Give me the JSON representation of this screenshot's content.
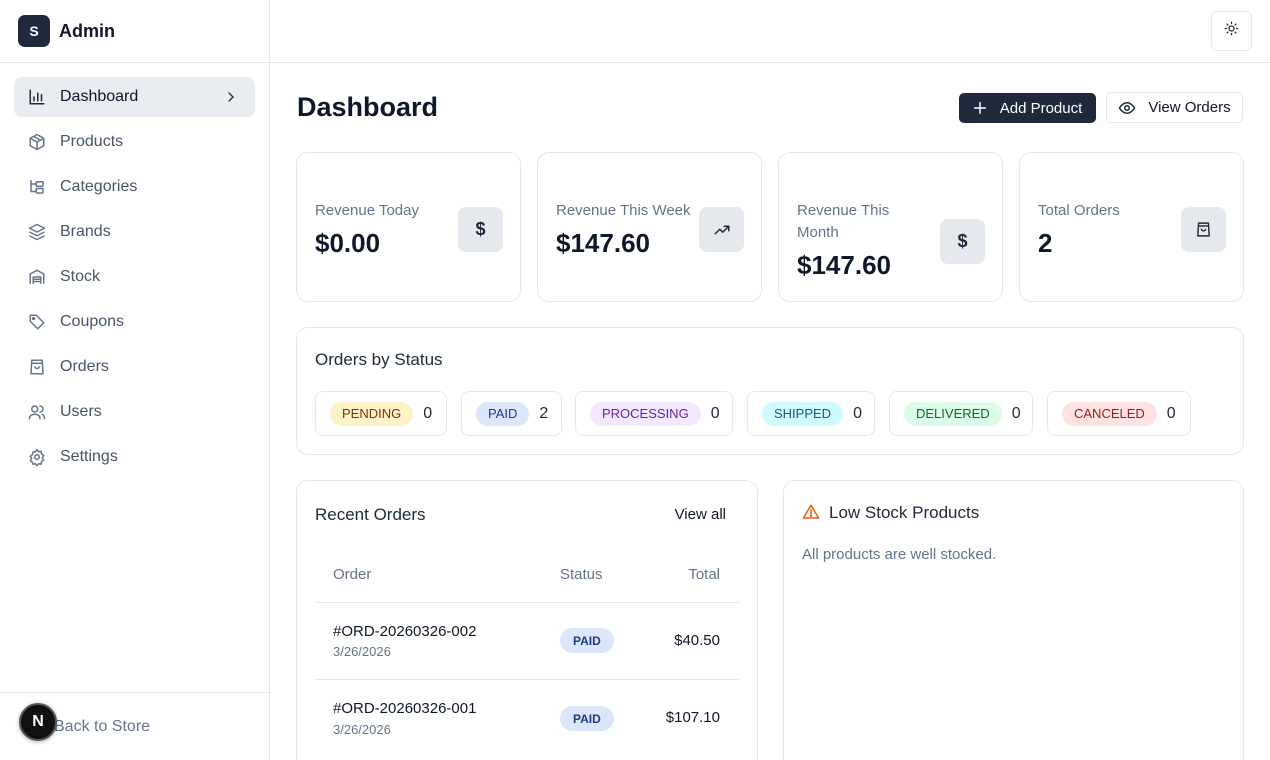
{
  "brand": {
    "logo_letter": "S",
    "name": "Admin"
  },
  "sidebar": {
    "items": [
      {
        "label": "Dashboard",
        "icon": "bar-chart-icon",
        "active": true
      },
      {
        "label": "Products",
        "icon": "package-icon"
      },
      {
        "label": "Categories",
        "icon": "folder-tree-icon"
      },
      {
        "label": "Brands",
        "icon": "layers-icon"
      },
      {
        "label": "Stock",
        "icon": "warehouse-icon"
      },
      {
        "label": "Coupons",
        "icon": "tag-icon"
      },
      {
        "label": "Orders",
        "icon": "shopping-bag-icon"
      },
      {
        "label": "Users",
        "icon": "users-icon"
      },
      {
        "label": "Settings",
        "icon": "gear-icon"
      }
    ],
    "footer_label": "Back to Store",
    "dev_badge": "N"
  },
  "header": {
    "theme_icon": "sun-icon"
  },
  "page": {
    "title": "Dashboard",
    "add_product_label": "Add Product",
    "view_orders_label": "View Orders"
  },
  "stats": [
    {
      "label": "Revenue Today",
      "value": "$0.00",
      "icon": "dollar-icon"
    },
    {
      "label": "Revenue This Week",
      "value": "$147.60",
      "icon": "trending-up-icon"
    },
    {
      "label": "Revenue This Month",
      "value": "$147.60",
      "icon": "dollar-icon"
    },
    {
      "label": "Total Orders",
      "value": "2",
      "icon": "shopping-bag-icon"
    }
  ],
  "orders_by_status": {
    "title": "Orders by Status",
    "items": [
      {
        "label": "PENDING",
        "count": "0",
        "bg": "#fef3c7",
        "fg": "#78350f"
      },
      {
        "label": "PAID",
        "count": "2",
        "bg": "#dbe6fa",
        "fg": "#1e3a8a"
      },
      {
        "label": "PROCESSING",
        "count": "0",
        "bg": "#f3e8ff",
        "fg": "#6b21a8"
      },
      {
        "label": "SHIPPED",
        "count": "0",
        "bg": "#cffafe",
        "fg": "#155e75"
      },
      {
        "label": "DELIVERED",
        "count": "0",
        "bg": "#dcfce7",
        "fg": "#166534"
      },
      {
        "label": "CANCELED",
        "count": "0",
        "bg": "#fee2e2",
        "fg": "#991b1b"
      }
    ]
  },
  "recent_orders": {
    "title": "Recent Orders",
    "view_all": "View all",
    "columns": [
      "Order",
      "Status",
      "Total"
    ],
    "rows": [
      {
        "id": "#ORD-20260326-002",
        "date": "3/26/2026",
        "status": "PAID",
        "total": "$40.50"
      },
      {
        "id": "#ORD-20260326-001",
        "date": "3/26/2026",
        "status": "PAID",
        "total": "$107.10"
      }
    ]
  },
  "low_stock": {
    "title": "Low Stock Products",
    "message": "All products are well stocked.",
    "icon": "warning-icon",
    "accent": "#ea580c"
  }
}
